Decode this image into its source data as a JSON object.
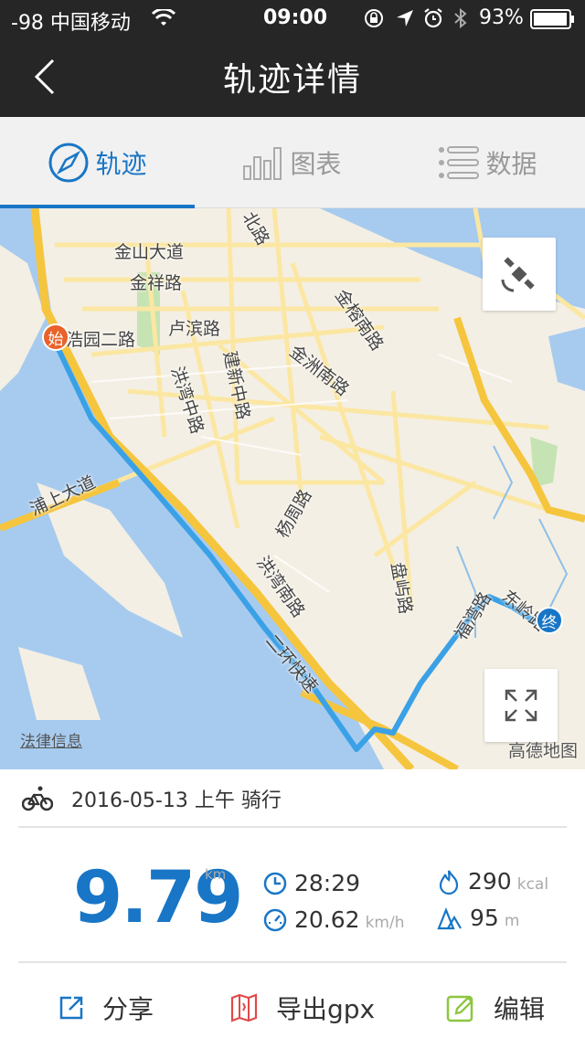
{
  "status_bar": {
    "signal": "-98 中国移动",
    "time": "09:00",
    "battery": "93%"
  },
  "nav": {
    "title": "轨迹详情"
  },
  "tabs": [
    {
      "label": "轨迹",
      "icon": "compass-icon"
    },
    {
      "label": "图表",
      "icon": "bar-chart-icon"
    },
    {
      "label": "数据",
      "icon": "list-icon"
    }
  ],
  "map": {
    "roads": [
      "金山大道",
      "金祥路",
      "卢滨路",
      "浩园二路",
      "洪湾中路",
      "建新中路",
      "金洲南路",
      "金榕南路",
      "杨周路",
      "浦上大道",
      "洪湾南路",
      "二环快速",
      "盘屿路",
      "福湾路",
      "东岭路",
      "北路"
    ],
    "start_label": "始",
    "end_label": "终",
    "legal": "法律信息",
    "provider": "高德地图"
  },
  "ride": {
    "date": "2016-05-13 上午 骑行"
  },
  "stats": {
    "distance": "9.79",
    "distance_unit": "km",
    "duration": "28:29",
    "speed": "20.62",
    "speed_unit": "km/h",
    "calories": "290",
    "calories_unit": "kcal",
    "elevation": "95",
    "elevation_unit": "m"
  },
  "actions": {
    "share": "分享",
    "export": "导出gpx",
    "edit": "编辑"
  },
  "colors": {
    "accent": "#1976c6",
    "track": "#3aa1e6",
    "start_pin": "#e8622a",
    "end_pin": "#1976c6"
  }
}
